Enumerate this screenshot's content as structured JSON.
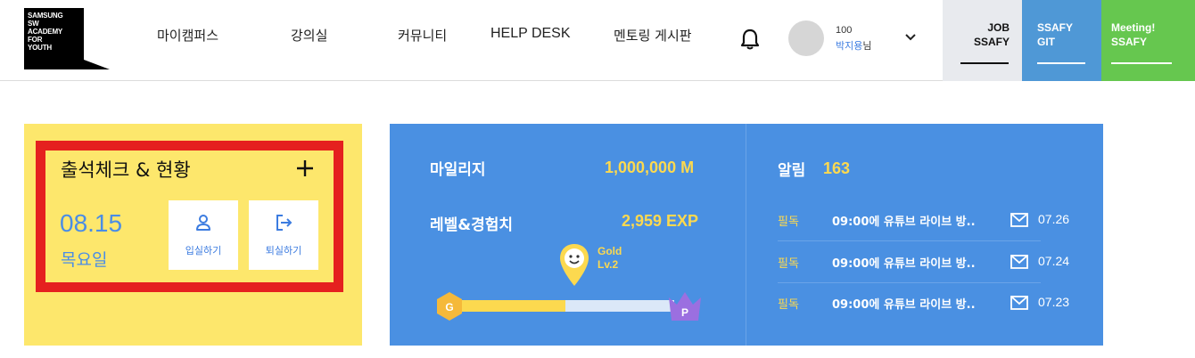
{
  "header": {
    "logo_lines": [
      "SAMSUNG",
      "SW",
      "ACADEMY",
      "FOR",
      "YOUTH"
    ],
    "nav": [
      {
        "label": "마이캠퍼스"
      },
      {
        "label": "강의실"
      },
      {
        "label": "커뮤니티"
      },
      {
        "label": "HELP DESK"
      },
      {
        "label": "멘토링 게시판"
      }
    ],
    "user": {
      "number": "100",
      "name": "박지용",
      "suffix": "님"
    },
    "side_buttons": [
      {
        "line1": "JOB",
        "line2": "SSAFY"
      },
      {
        "line1": "SSAFY",
        "line2": "GIT"
      },
      {
        "line1": "Meeting!",
        "line2": "SSAFY"
      }
    ]
  },
  "attendance": {
    "title": "출석체크 & 현황",
    "date": "08.15",
    "weekday": "목요일",
    "checkin_label": "입실하기",
    "checkout_label": "퇴실하기"
  },
  "stats": {
    "mileage_label": "마일리지",
    "mileage_value": "1,000,000 M",
    "level_label": "레벨&경험치",
    "level_value": "2,959 EXP",
    "grade_name": "Gold",
    "grade_level": "Lv.2",
    "start_badge": "G",
    "end_badge": "P",
    "progress": 0.51
  },
  "notifications": {
    "title": "알림",
    "count": "163",
    "items": [
      {
        "tag": "필독",
        "text": "09:00에 유튜브 라이브 방..",
        "date": "07.26"
      },
      {
        "tag": "필독",
        "text": "09:00에 유튜브 라이브 방..",
        "date": "07.24"
      },
      {
        "tag": "필독",
        "text": "09:00에 유튜브 라이브 방..",
        "date": "07.23"
      }
    ]
  },
  "colors": {
    "brand_blue": "#4a90e2",
    "accent_yellow": "#fcd94f",
    "card_yellow": "#fde76c",
    "highlight_red": "#e5201f",
    "git_blue": "#4f98d6",
    "meeting_green": "#66c74f"
  },
  "icons": [
    "bell-icon",
    "chevron-down-icon",
    "plus-icon",
    "user-icon",
    "logout-icon",
    "gold-pin-icon",
    "mail-icon"
  ]
}
